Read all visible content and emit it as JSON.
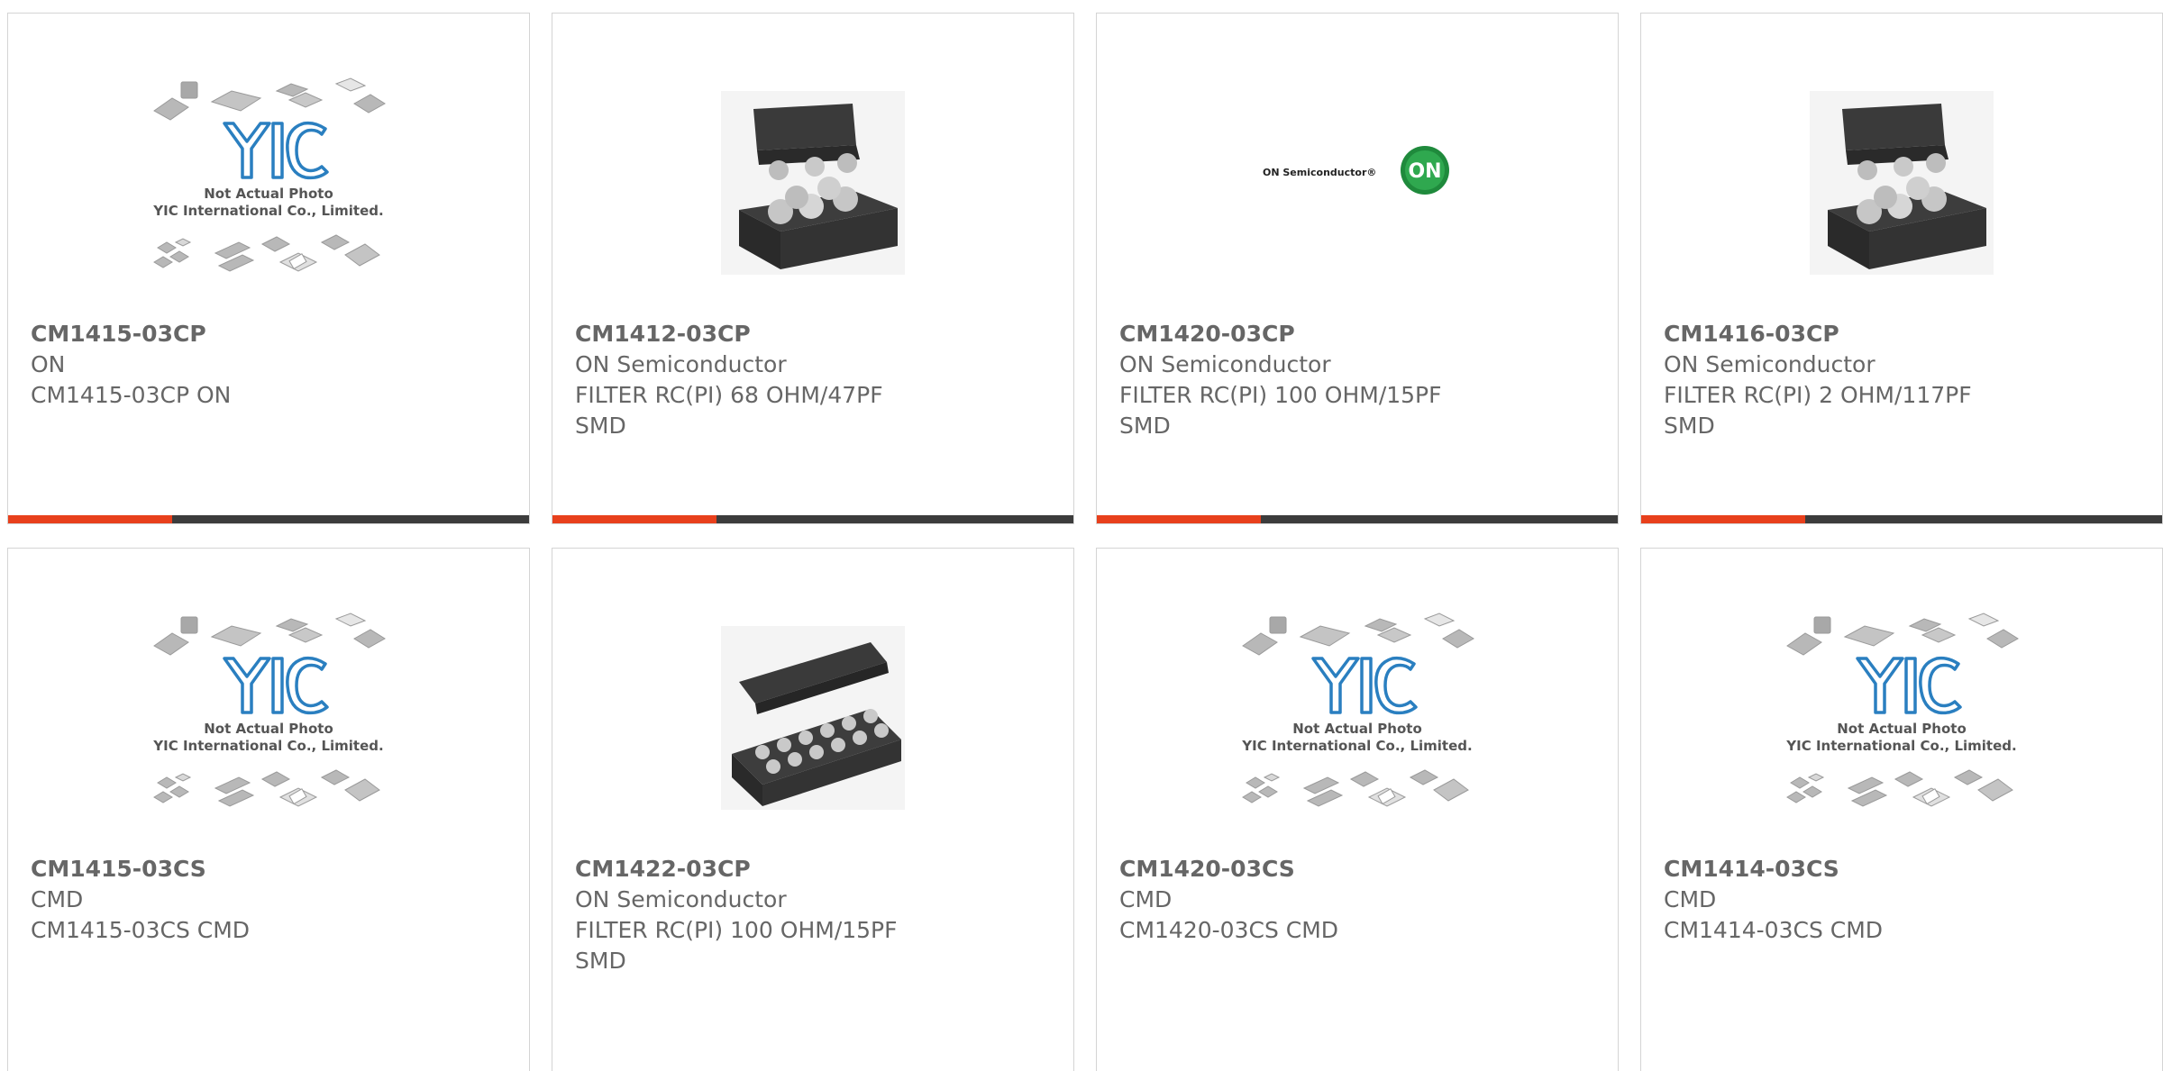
{
  "placeholder": {
    "line1": "Not Actual Photo",
    "line2": "YIC International Co., Limited."
  },
  "onlogo": {
    "brand": "ON Semiconductor",
    "mark": "ON"
  },
  "colors": {
    "accent": "#e8401c",
    "bar": "#3c3c3c",
    "text": "#666666",
    "yic_blue": "#2a7fc0"
  },
  "products": [
    {
      "part": "CM1415-03CP",
      "maker": "ON",
      "desc": "CM1415-03CP ON",
      "image": "placeholder-image"
    },
    {
      "part": "CM1412-03CP",
      "maker": "ON Semiconductor",
      "desc": "FILTER RC(PI) 68 OHM/47PF SMD",
      "image": "chip-small-image"
    },
    {
      "part": "CM1420-03CP",
      "maker": "ON Semiconductor",
      "desc": "FILTER RC(PI) 100 OHM/15PF SMD",
      "image": "on-logo-image"
    },
    {
      "part": "CM1416-03CP",
      "maker": "ON Semiconductor",
      "desc": "FILTER RC(PI) 2 OHM/117PF SMD",
      "image": "chip-small-image"
    },
    {
      "part": "CM1415-03CS",
      "maker": "CMD",
      "desc": "CM1415-03CS CMD",
      "image": "placeholder-image"
    },
    {
      "part": "CM1422-03CP",
      "maker": "ON Semiconductor",
      "desc": "FILTER RC(PI) 100 OHM/15PF SMD",
      "image": "chip-long-image"
    },
    {
      "part": "CM1420-03CS",
      "maker": "CMD",
      "desc": "CM1420-03CS CMD",
      "image": "placeholder-image"
    },
    {
      "part": "CM1414-03CS",
      "maker": "CMD",
      "desc": "CM1414-03CS CMD",
      "image": "placeholder-image"
    }
  ]
}
